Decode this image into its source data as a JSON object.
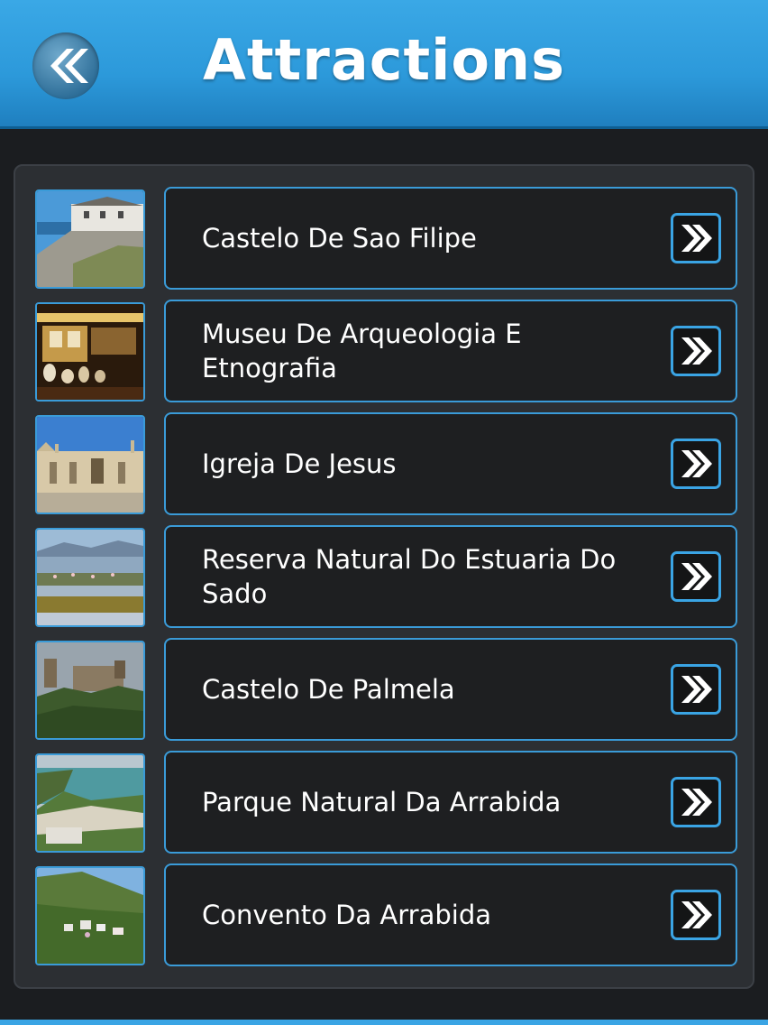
{
  "header": {
    "title": "Attractions",
    "back_icon": "double-chevron-left-icon",
    "accent": "#2c99da"
  },
  "list": {
    "items": [
      {
        "label": "Castelo De Sao Filipe",
        "thumb": "coastal fortress photo"
      },
      {
        "label": "Museu De Arqueologia E Etnografia",
        "thumb": "museum interior photo"
      },
      {
        "label": "Igreja De Jesus",
        "thumb": "church facade photo"
      },
      {
        "label": "Reserva Natural Do Estuaria Do Sado",
        "thumb": "estuary wetland photo"
      },
      {
        "label": "Castelo De Palmela",
        "thumb": "hilltop castle photo"
      },
      {
        "label": "Parque Natural Da Arrabida",
        "thumb": "coastline park photo"
      },
      {
        "label": "Convento Da Arrabida",
        "thumb": "hillside convent photo"
      }
    ],
    "chevron_icon": "double-chevron-right-icon",
    "border_color": "#3a9bd8"
  }
}
